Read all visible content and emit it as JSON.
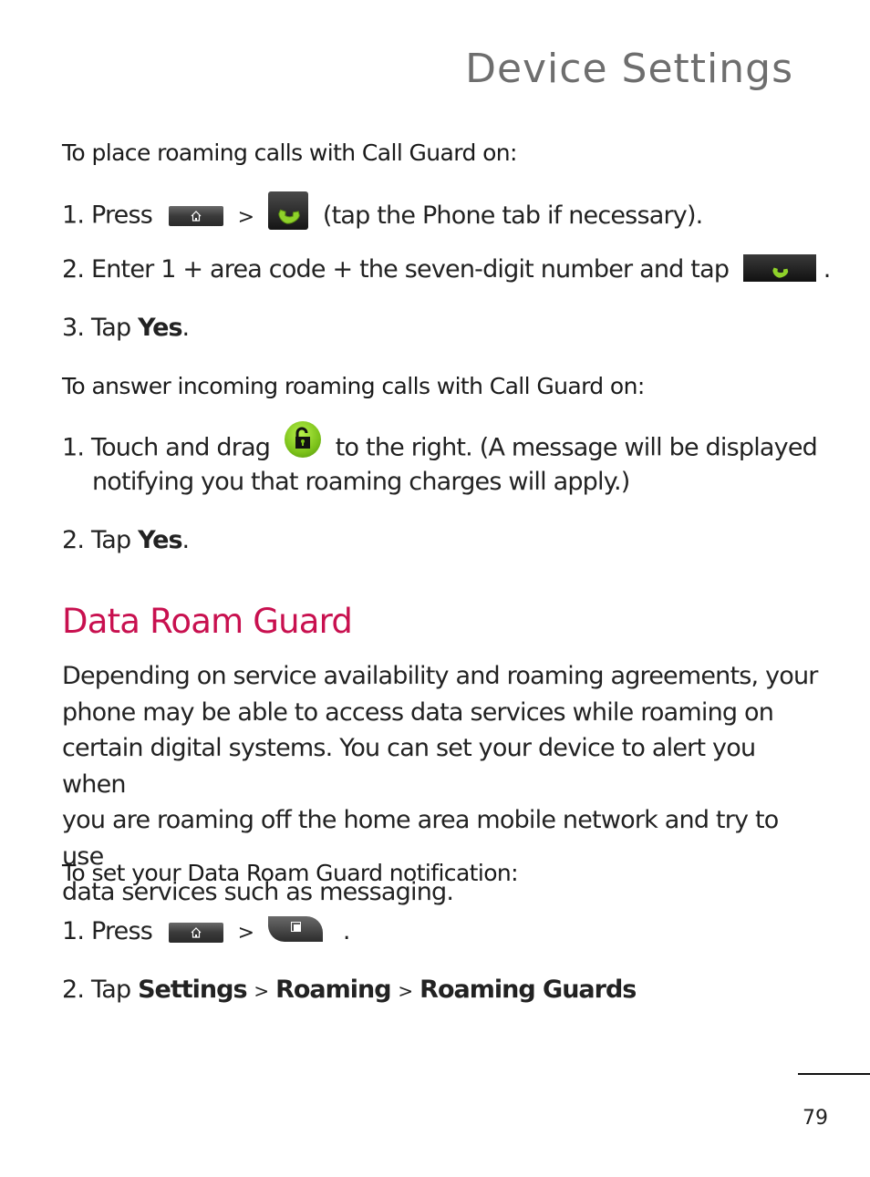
{
  "header": {
    "title": "Device Settings"
  },
  "section1": {
    "subheading": "To place roaming calls with Call Guard on:",
    "steps": [
      {
        "num": "1.",
        "text_a": "Press",
        "sep": ">",
        "text_b": "(tap the Phone tab if necessary).",
        "icons": [
          "home-key-icon",
          "phone-tab-icon"
        ]
      },
      {
        "num": "2.",
        "text_a": "Enter 1 + area code + the seven-digit number and tap",
        "text_b": ".",
        "icons": [
          "call-button-icon"
        ]
      },
      {
        "num": "3.",
        "text_a": "Tap",
        "bold": "Yes",
        "text_b": "."
      }
    ]
  },
  "section2": {
    "subheading": "To answer incoming roaming calls with Call Guard on:",
    "steps": [
      {
        "num": "1.",
        "text_a": "Touch and drag",
        "text_b": "to the right. (A message will be displayed",
        "text_c": "notifying you that roaming charges will apply.)",
        "icons": [
          "unlock-icon"
        ]
      },
      {
        "num": "2.",
        "text_a": "Tap",
        "bold": "Yes",
        "text_b": "."
      }
    ]
  },
  "data_roam_guard": {
    "heading": "Data Roam Guard",
    "paragraph": [
      "Depending on service availability and roaming agreements, your",
      "phone may be able to access data services while roaming on",
      "certain digital systems. You can set your device to alert you when",
      "you are roaming off the home area mobile network and try to use",
      "data services such as messaging."
    ],
    "subheading": "To set your Data Roam Guard notification:",
    "steps": [
      {
        "num": "1.",
        "text_a": "Press",
        "sep": ">",
        "text_b": ".",
        "icons": [
          "home-key-icon",
          "menu-key-icon"
        ]
      },
      {
        "num": "2.",
        "text_a": "Tap",
        "path": [
          "Settings",
          "Roaming",
          "Roaming Guards"
        ],
        "sep": ">"
      }
    ]
  },
  "footer": {
    "page_number": "79"
  },
  "colors": {
    "heading_accent": "#c8104f",
    "title_gray": "#6e6e6e",
    "icon_green": "#7cc21a"
  }
}
